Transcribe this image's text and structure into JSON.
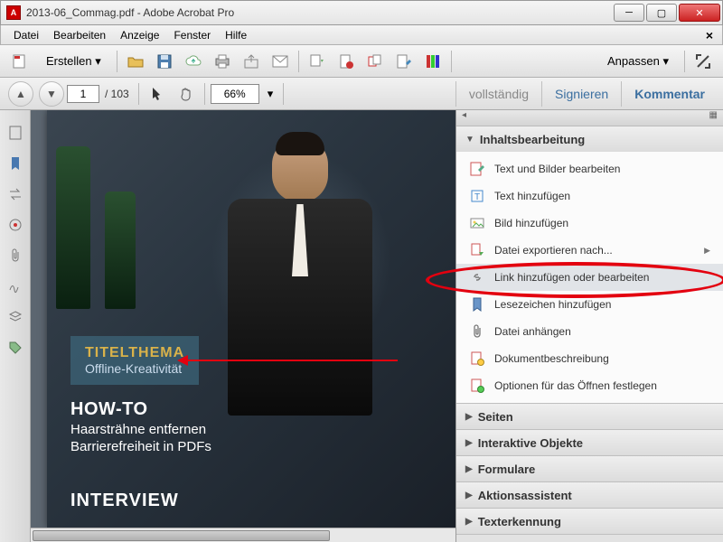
{
  "window": {
    "title": "2013-06_Commag.pdf - Adobe Acrobat Pro"
  },
  "menu": {
    "items": [
      "Datei",
      "Bearbeiten",
      "Anzeige",
      "Fenster",
      "Hilfe"
    ]
  },
  "toolbar": {
    "create_label": "Erstellen",
    "customize_label": "Anpassen"
  },
  "nav": {
    "current_page": "1",
    "page_count": "103",
    "zoom": "66%",
    "tabs": {
      "full": "vollständig",
      "sign": "Signieren",
      "comment": "Kommentar"
    }
  },
  "document": {
    "titelthema_label": "TITELTHEMA",
    "titelthema_sub": "Offline-Kreativität",
    "howto_label": "HOW-TO",
    "howto_line1": "Haarsträhne entfernen",
    "howto_line2": "Barrierefreiheit in PDFs",
    "interview_label": "INTERVIEW"
  },
  "rightpanel": {
    "sections": {
      "content_editing": "Inhaltsbearbeitung",
      "pages": "Seiten",
      "interactive": "Interaktive Objekte",
      "forms": "Formulare",
      "actions": "Aktionsassistent",
      "ocr": "Texterkennung"
    },
    "tools": {
      "edit_text_images": "Text und Bilder bearbeiten",
      "add_text": "Text hinzufügen",
      "add_image": "Bild hinzufügen",
      "export_file": "Datei exportieren nach...",
      "add_edit_link": "Link hinzufügen oder bearbeiten",
      "add_bookmark": "Lesezeichen hinzufügen",
      "attach_file": "Datei anhängen",
      "doc_description": "Dokumentbeschreibung",
      "open_options": "Optionen für das Öffnen festlegen"
    }
  }
}
